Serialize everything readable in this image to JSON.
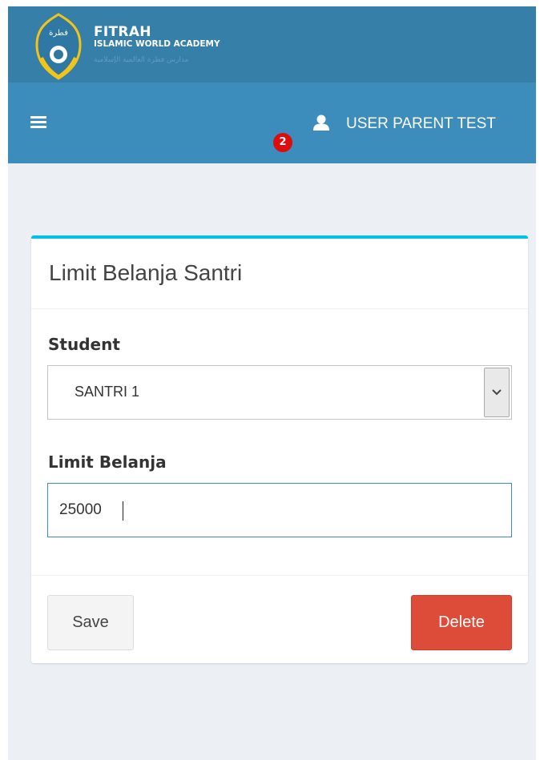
{
  "brand": {
    "name": "FITRAH",
    "subtitle": "ISLAMIC WORLD ACADEMY",
    "tagline_arabic": "مدارس فطرة العالمية الإسلامية",
    "logo_text": "فطرة",
    "colors": {
      "logo_bar": "#367fa9",
      "navbar": "#3c8dbc",
      "accent": "#00c0ef"
    }
  },
  "navbar": {
    "menu_icon": "hamburger-icon",
    "user_icon": "user-icon",
    "user_name": "USER PARENT TEST",
    "notification_count": "2"
  },
  "form": {
    "title": "Limit Belanja Santri",
    "student_label": "Student",
    "student_selected": "SANTRI 1",
    "limit_label": "Limit Belanja",
    "limit_value": "25000",
    "save_label": "Save",
    "delete_label": "Delete",
    "delete_color": "#dd4b39"
  }
}
